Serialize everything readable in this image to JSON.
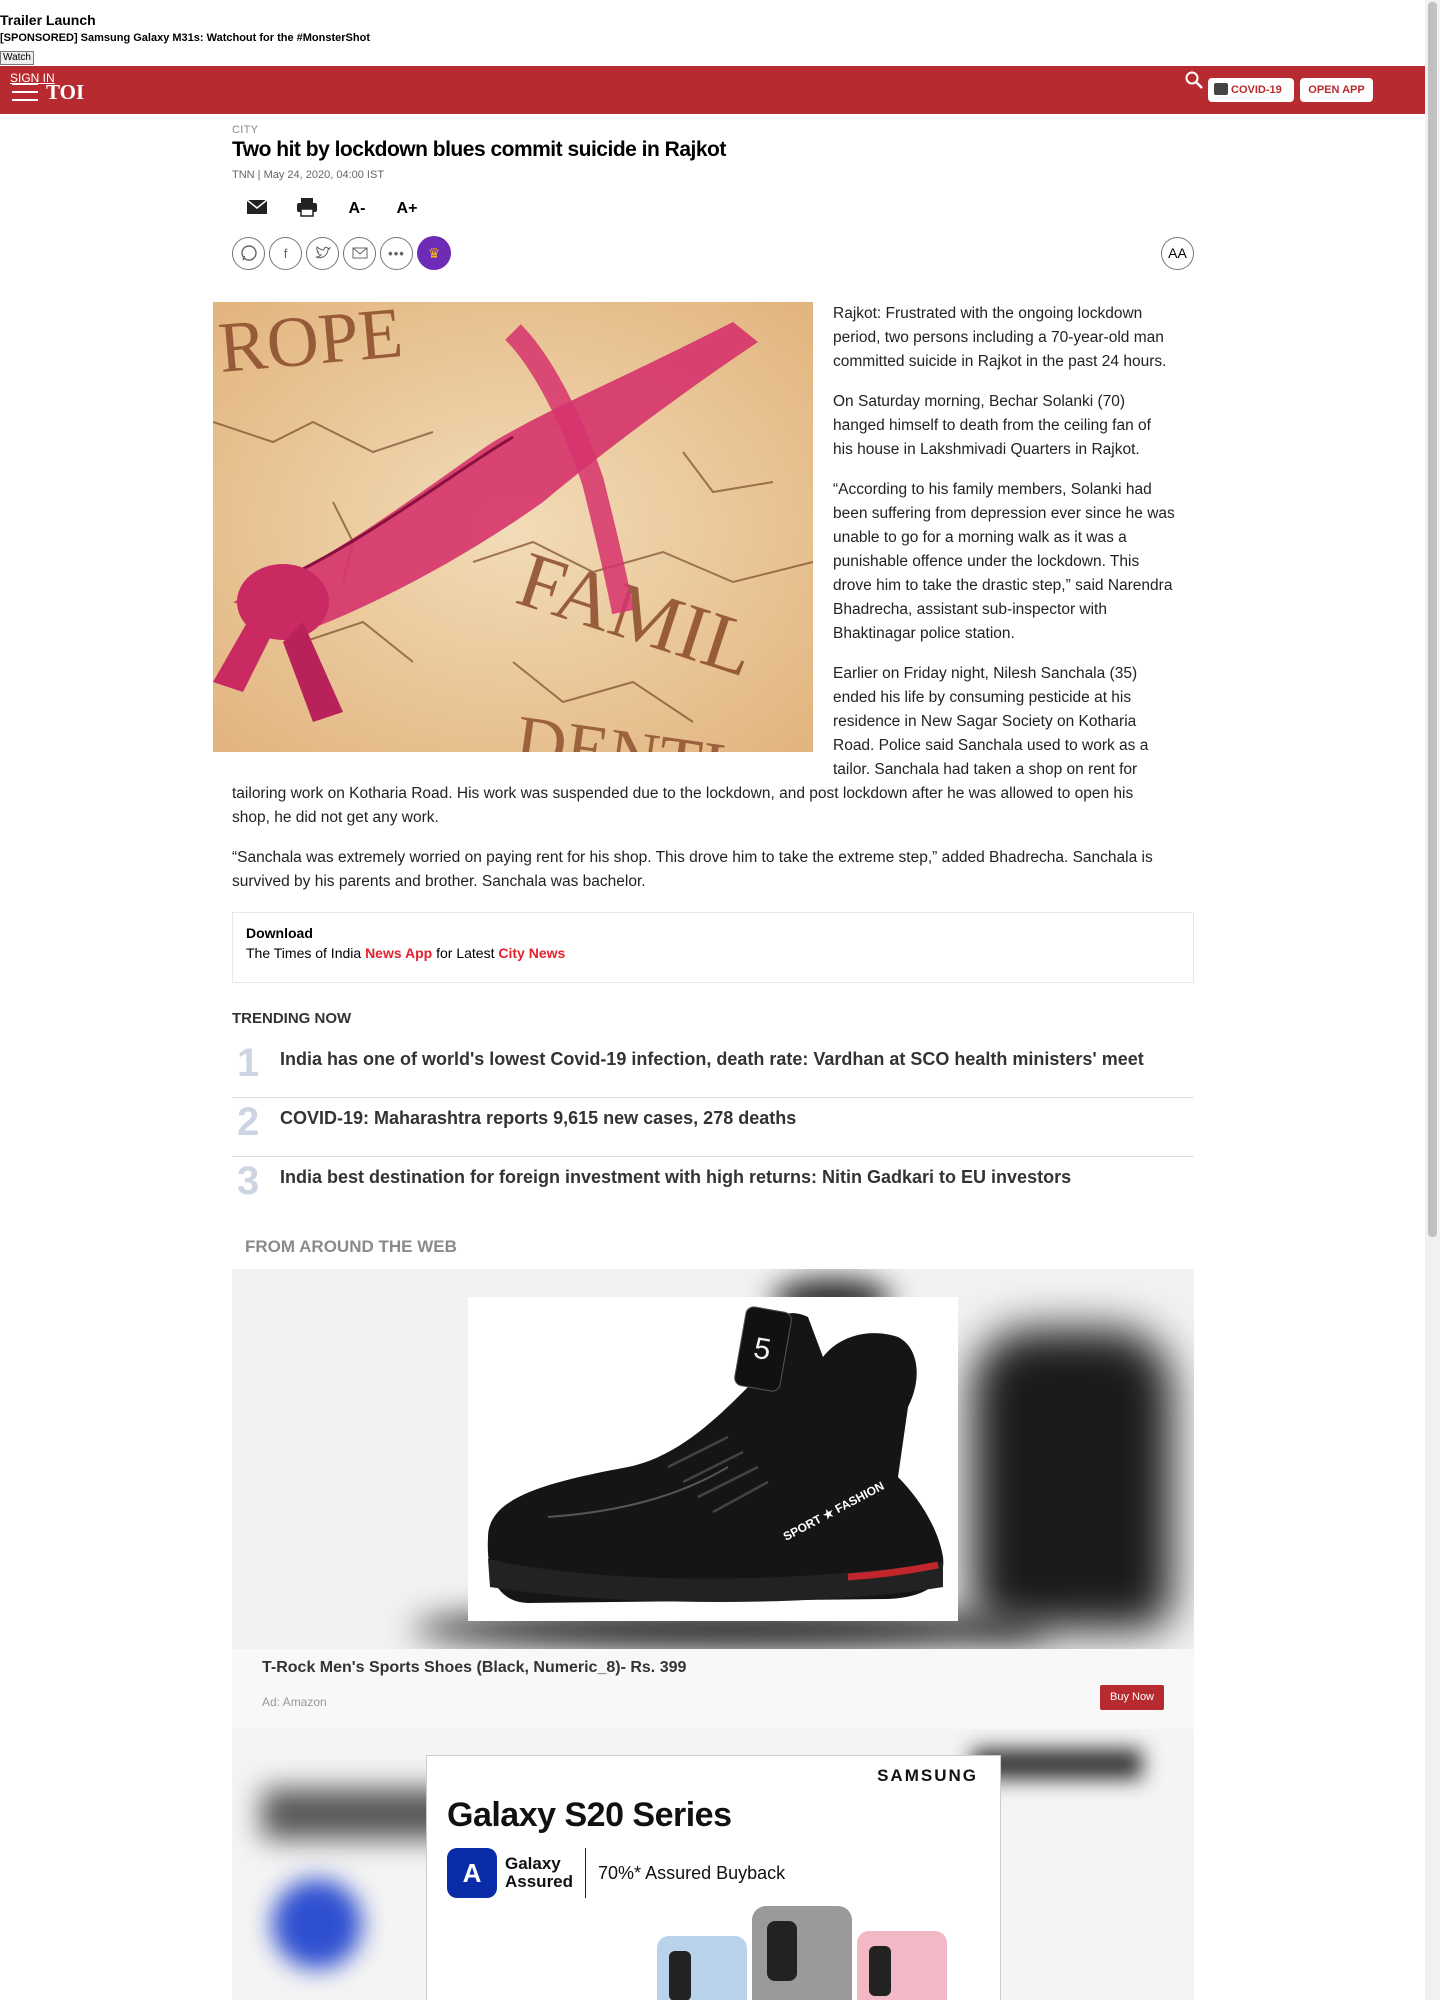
{
  "banner": {
    "title": "Trailer Launch",
    "sponsored": "[SPONSORED] Samsung Galaxy M31s: Watchout for the #MonsterShot",
    "watch": "Watch"
  },
  "header": {
    "signin": "SIGN IN",
    "logo": "TOI",
    "covid_label": "COVID-19",
    "open_app_label": "OPEN APP",
    "brand_color": "#b72b30"
  },
  "article": {
    "section": "CITY",
    "title": "Two hit by lockdown blues commit suicide in Rajkot",
    "byline": "TNN | May 24, 2020, 04:00 IST",
    "tools": {
      "font_decrease": "A-",
      "font_increase": "A+"
    },
    "aa_label": "AA",
    "image_text": {
      "top": "ROPE",
      "middle": "FAMIL",
      "bottom": "DENTI"
    },
    "paragraphs": [
      "Rajkot: Frustrated with the ongoing lockdown period, two persons including a 70-year-old man committed suicide in Rajkot in the past 24 hours.",
      "On Saturday morning, Bechar Solanki (70) hanged himself to death from the ceiling fan of his house in Lakshmivadi Quarters in Rajkot.",
      "“According to his family members, Solanki had been suffering from depression ever since he was unable to go for a morning walk as it was a punishable offence under the lockdown. This drove him to take the drastic step,” said Narendra Bhadrecha, assistant sub-inspector with Bhaktinagar police station.",
      "Earlier on Friday night, Nilesh Sanchala (35) ended his life by consuming pesticide at his residence in New Sagar Society on Kotharia Road. Police said Sanchala used to work as a tailor. Sanchala had taken a shop on rent for tailoring work on Kotharia Road. His work was suspended due to the lockdown, and post lockdown after he was allowed to open his shop, he did not get any work.",
      "“Sanchala was extremely worried on paying rent for his shop. This drove him to take the extreme step,” added Bhadrecha. Sanchala is survived by his parents and brother. Sanchala was bachelor."
    ]
  },
  "download": {
    "heading": "Download",
    "prefix": "The Times of India",
    "news_app": "News App",
    "middle": "for Latest",
    "city_news": "City News"
  },
  "trending": {
    "title": "TRENDING NOW",
    "items": [
      {
        "num": "1",
        "text": "India has one of world's lowest Covid-19 infection, death rate: Vardhan at SCO health ministers' meet"
      },
      {
        "num": "2",
        "text": "COVID-19: Maharashtra reports 9,615 new cases, 278 deaths"
      },
      {
        "num": "3",
        "text": "India best destination for foreign investment with high returns: Nitin Gadkari to EU investors"
      }
    ]
  },
  "around_web": {
    "title": "FROM AROUND THE WEB",
    "ad1": {
      "caption": "T-Rock Men's Sports Shoes (Black, Numeric_8)- Rs. 399",
      "source": "Ad: Amazon",
      "buy_label": "Buy Now",
      "shoe_text": "SPORT ★ FASHION"
    },
    "ad2": {
      "brand": "SAMSUNG",
      "product": "Galaxy S20 Series",
      "assured_line1": "Galaxy",
      "assured_line2": "Assured",
      "buyback": "70%* Assured Buyback"
    }
  }
}
